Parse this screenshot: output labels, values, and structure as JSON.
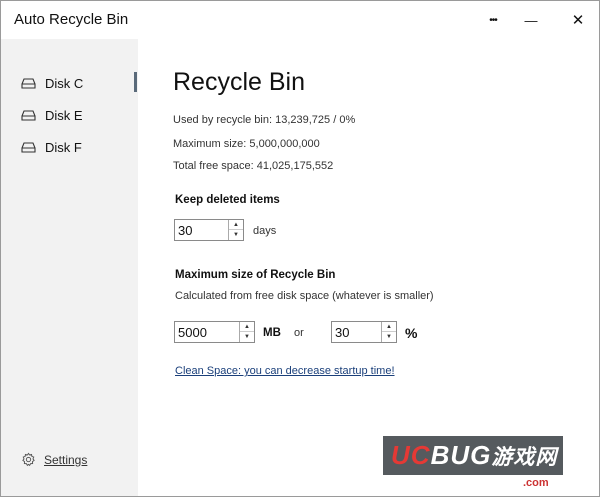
{
  "window": {
    "title": "Auto Recycle Bin"
  },
  "titlebar": {
    "more": "•••",
    "minimize": "—",
    "close": "✕"
  },
  "sidebar": {
    "items": [
      {
        "label": "Disk C"
      },
      {
        "label": "Disk E"
      },
      {
        "label": "Disk F"
      }
    ],
    "active_index": 0,
    "settings_label": "Settings"
  },
  "main": {
    "title": "Recycle Bin",
    "used_by_recycle_bin": "Used by recycle bin: 13,239,725 / 0%",
    "maximum_size": "Maximum size: 5,000,000,000",
    "total_free_space": "Total free space: 41,025,175,552",
    "keep_deleted": {
      "title": "Keep deleted items",
      "value": "30",
      "unit": "days"
    },
    "max_size": {
      "title": "Maximum size of Recycle Bin",
      "description": "Calculated from free disk space (whatever is smaller)",
      "mb_value": "5000",
      "mb_unit": "MB",
      "or_label": "or",
      "percent_value": "30",
      "percent_unit": "%"
    },
    "clean_link": "Clean Space: you can decrease startup time!"
  },
  "watermark": {
    "letters": [
      "U",
      "C",
      "B",
      "U",
      "G",
      "游",
      "戏",
      "网"
    ],
    "colors": [
      "#e53935",
      "#e53935",
      "#ffffff",
      "#ffffff",
      "#ffffff",
      "#ffffff",
      "#ffffff",
      "#ffffff"
    ],
    "sub": ".com"
  }
}
